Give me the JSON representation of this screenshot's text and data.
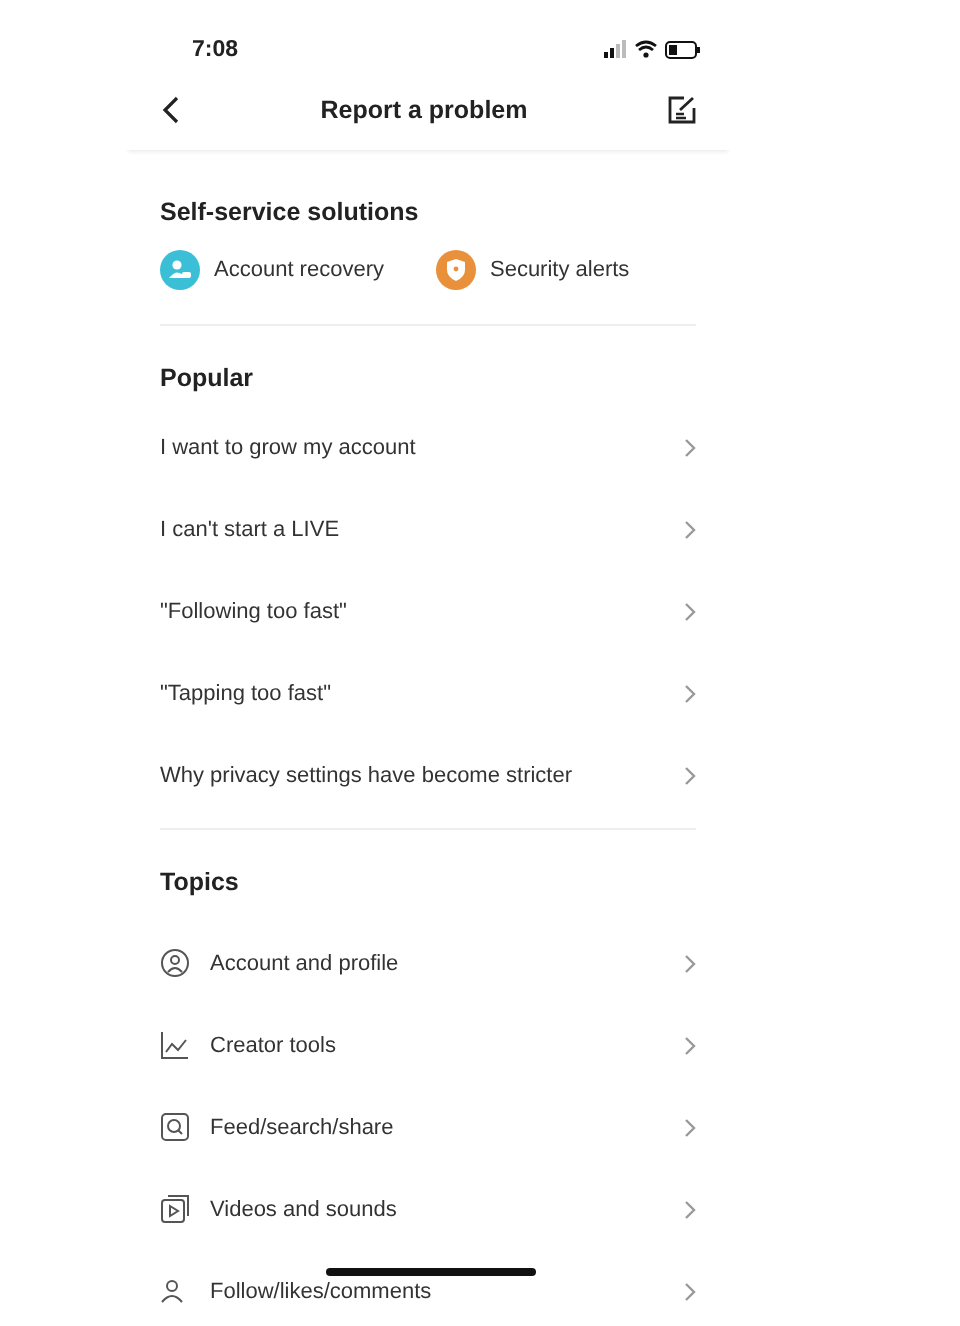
{
  "status_bar": {
    "time": "7:08"
  },
  "header": {
    "title": "Report a problem"
  },
  "self_service": {
    "title": "Self-service solutions",
    "items": [
      {
        "label": "Account recovery",
        "color": "#3bbfd6",
        "kind": "account"
      },
      {
        "label": "Security alerts",
        "color": "#e8913a",
        "kind": "shield"
      }
    ]
  },
  "popular": {
    "title": "Popular",
    "items": [
      {
        "label": "I want to grow my account"
      },
      {
        "label": "I can't start a LIVE"
      },
      {
        "label": "\"Following too fast\""
      },
      {
        "label": "\"Tapping too fast\""
      },
      {
        "label": "Why privacy settings have become stricter"
      }
    ]
  },
  "topics": {
    "title": "Topics",
    "items": [
      {
        "label": "Account and profile",
        "kind": "person"
      },
      {
        "label": "Creator tools",
        "kind": "chart"
      },
      {
        "label": "Feed/search/share",
        "kind": "search"
      },
      {
        "label": "Videos and sounds",
        "kind": "video"
      },
      {
        "label": "Follow/likes/comments",
        "kind": "follow"
      }
    ]
  }
}
